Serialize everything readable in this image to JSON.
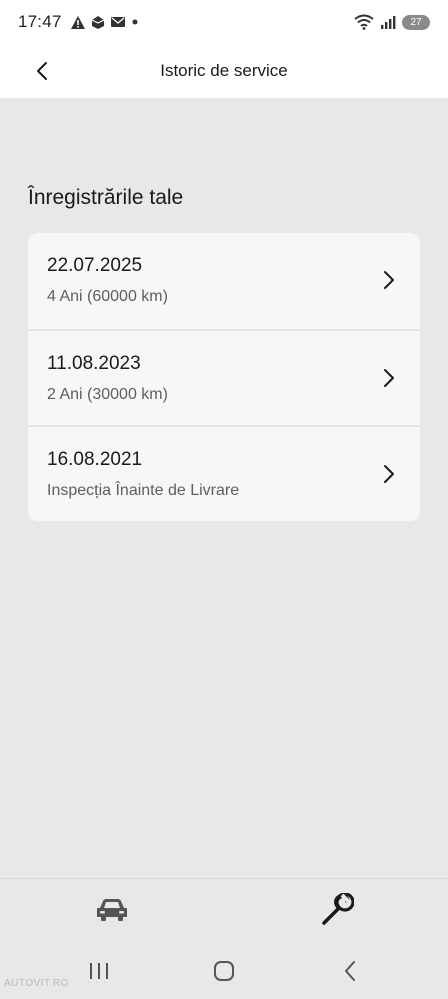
{
  "status_bar": {
    "time": "17:47",
    "battery": "27",
    "icons": [
      "alert-icon",
      "stack-icon",
      "mail-icon",
      "dot-icon",
      "wifi-icon",
      "signal-icon"
    ]
  },
  "header": {
    "title": "Istoric de service",
    "back_icon": "chevron-left-icon"
  },
  "main": {
    "heading": "Înregistrările tale",
    "records": [
      {
        "date": "22.07.2025",
        "description": "4 Ani (60000 km)"
      },
      {
        "date": "11.08.2023",
        "description": "2 Ani (30000 km)"
      },
      {
        "date": "16.08.2021",
        "description": "Inspecția Înainte de Livrare"
      }
    ]
  },
  "bottom_nav": {
    "tabs": [
      {
        "icon": "car-icon",
        "active": false
      },
      {
        "icon": "wrench-icon",
        "active": true
      }
    ]
  },
  "system_nav": [
    "recents-icon",
    "home-icon",
    "back-icon"
  ],
  "watermark": "AUTOVIT.RO",
  "colors": {
    "background": "#e9e8e6",
    "card": "#f7f7f6",
    "header": "#ffffff",
    "text": "#1a1a1a",
    "secondary_text": "#5e5e5e"
  }
}
